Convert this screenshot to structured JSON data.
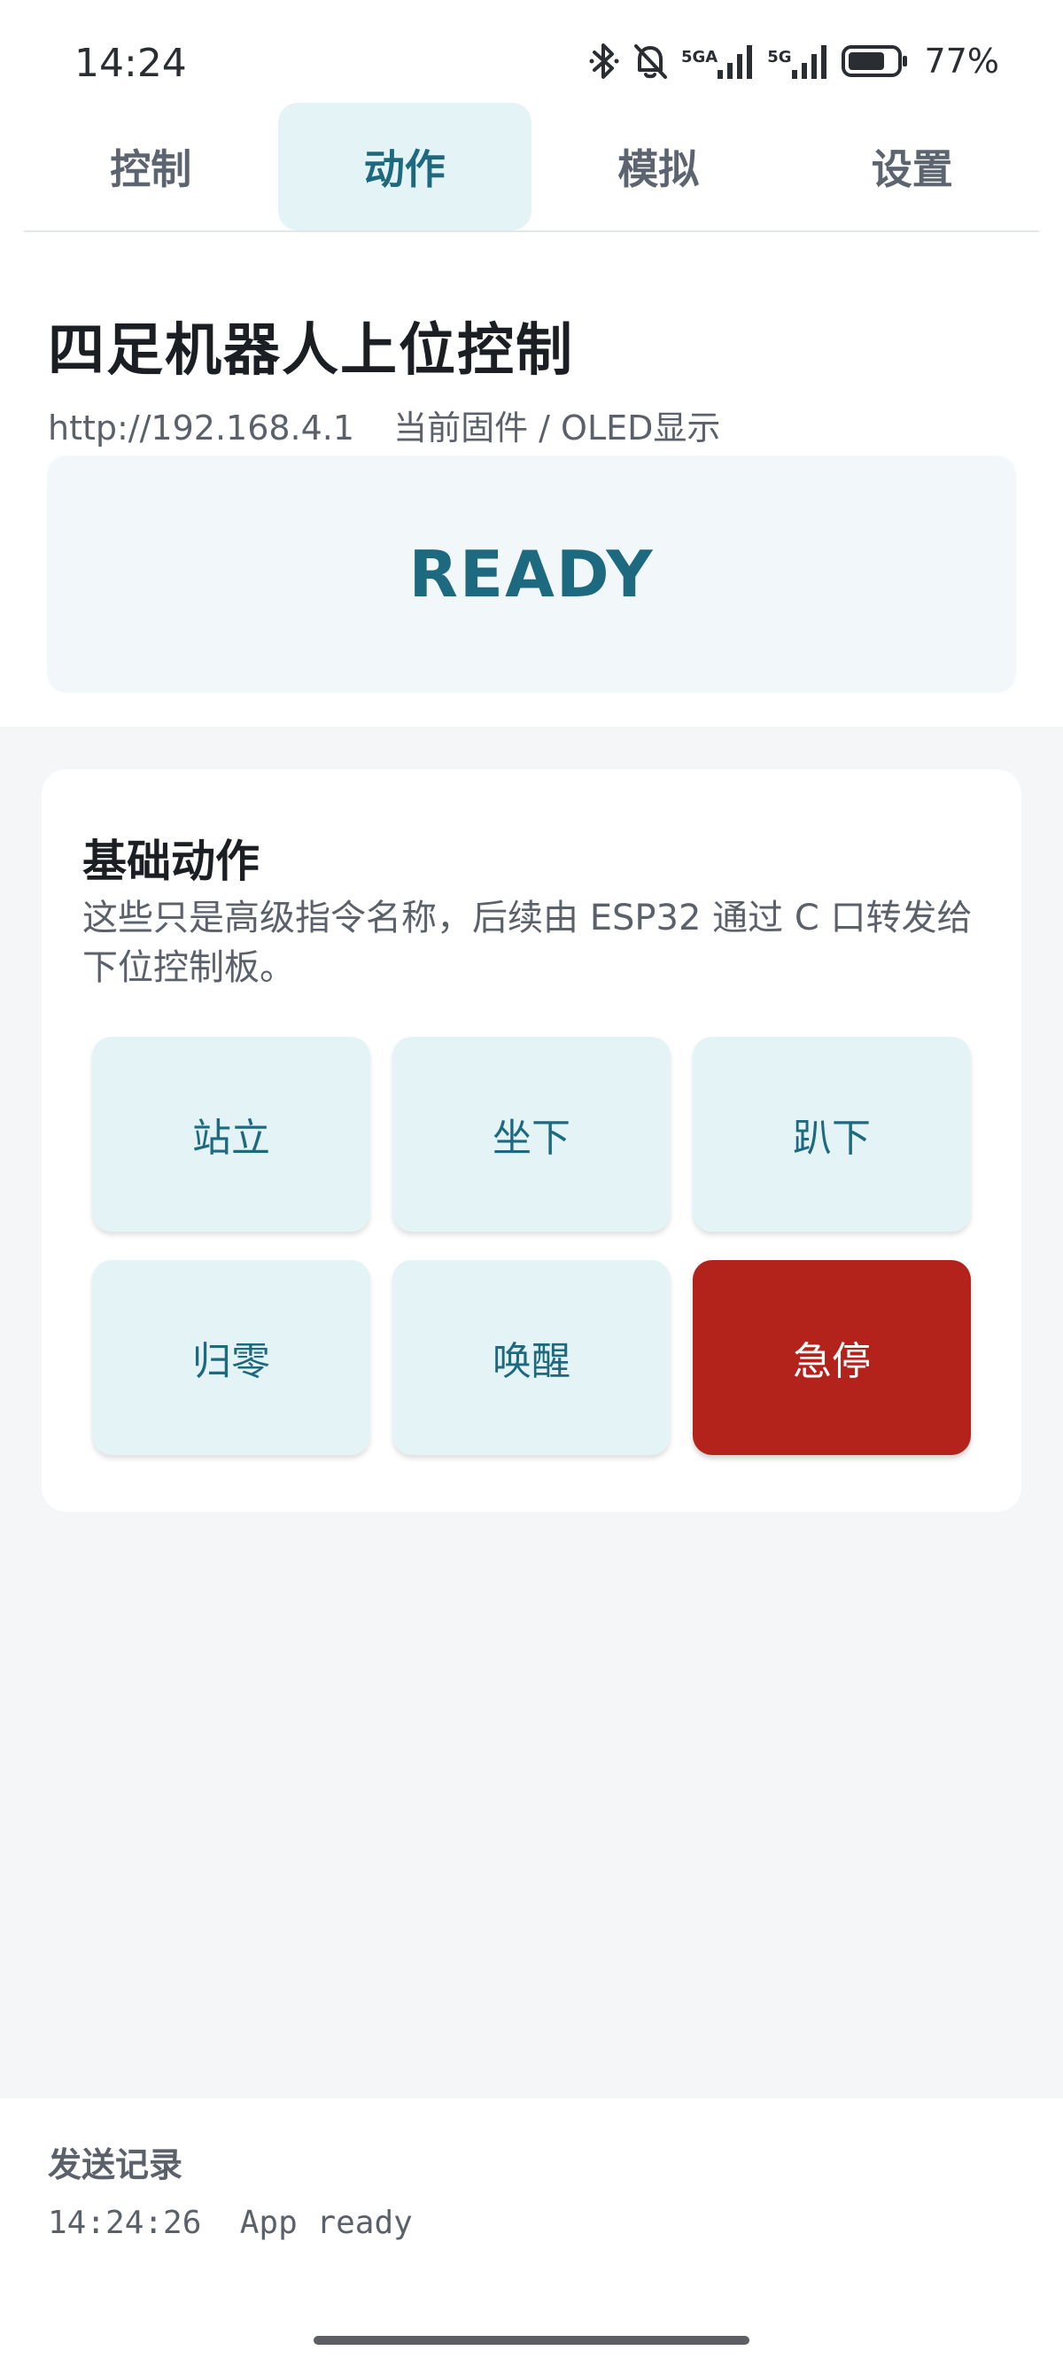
{
  "status_bar": {
    "time": "14:24",
    "battery_percent": "77%",
    "icons": [
      "bluetooth-icon",
      "bell-off-icon",
      "signal-5ga-icon",
      "signal-5g-icon",
      "battery-icon"
    ],
    "network_labels": [
      "5GA",
      "5G"
    ]
  },
  "tabs": [
    {
      "label": "控制",
      "active": false
    },
    {
      "label": "动作",
      "active": true
    },
    {
      "label": "模拟",
      "active": false
    },
    {
      "label": "设置",
      "active": false
    }
  ],
  "header": {
    "title": "四足机器人上位控制",
    "url": "http://192.168.4.1",
    "firmware": "当前固件 / OLED显示"
  },
  "display": {
    "status_text": "READY"
  },
  "actions_card": {
    "title": "基础动作",
    "description": "这些只是高级指令名称，后续由 ESP32 通过 C 口转发给下位控制板。",
    "buttons": [
      {
        "label": "站立",
        "variant": "normal"
      },
      {
        "label": "坐下",
        "variant": "normal"
      },
      {
        "label": "趴下",
        "variant": "normal"
      },
      {
        "label": "归零",
        "variant": "normal"
      },
      {
        "label": "唤醒",
        "variant": "normal"
      },
      {
        "label": "急停",
        "variant": "danger"
      }
    ]
  },
  "log": {
    "title": "发送记录",
    "entries": [
      {
        "time": "14:24:26",
        "message": "App ready"
      }
    ]
  },
  "colors": {
    "accent": "#1d6a80",
    "accent_bg": "#e4f3f6",
    "danger": "#b3221b",
    "page_bg": "#f4f6f8"
  }
}
